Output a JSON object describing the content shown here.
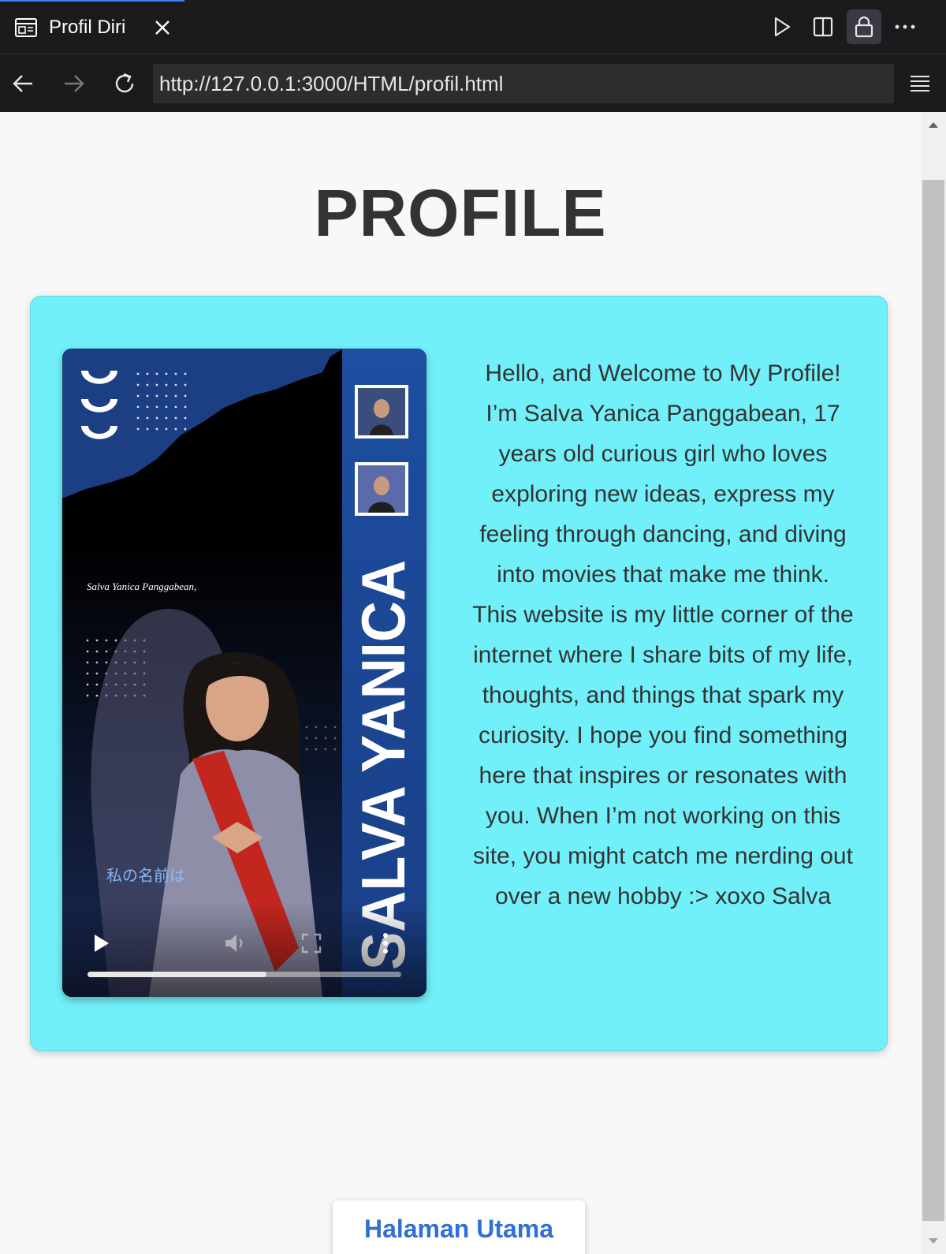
{
  "browser": {
    "tab": {
      "title": "Profil Diri",
      "icon": "browser-preview-icon",
      "close_icon": "close-icon"
    },
    "actions": [
      "play-icon",
      "split-view-icon",
      "lock-icon",
      "more-icon"
    ],
    "nav": {
      "back_icon": "arrow-left-icon",
      "forward_icon": "arrow-right-icon",
      "reload_icon": "reload-icon",
      "menu_icon": "hamburger-menu-icon"
    },
    "url": "http://127.0.0.1:3000/HTML/profil.html"
  },
  "page": {
    "title": "PROFILE",
    "card_color": "#72f0f9",
    "video": {
      "caption": "Salva Yanica Panggabean,",
      "japanese_text": "私の名前は",
      "vertical_name": "SALVA YANICA",
      "progress": 0.57,
      "controls": [
        "play-icon",
        "volume-icon",
        "fullscreen-icon",
        "more-vertical-icon"
      ]
    },
    "bio": "Hello, and Welcome to My Profile! I’m Salva Yanica Panggabean, 17 years old curious girl who loves exploring new ideas, express my feeling through dancing, and diving into movies that make me think. This website is my little corner of the internet where I share bits of my life, thoughts, and things that spark my curiosity. I hope you find something here that inspires or resonates with you. When I’m not working on this site, you might catch me nerding out over a new hobby :> xoxo Salva",
    "home_button": "Halaman Utama",
    "link_color": "#2f6fd6"
  }
}
